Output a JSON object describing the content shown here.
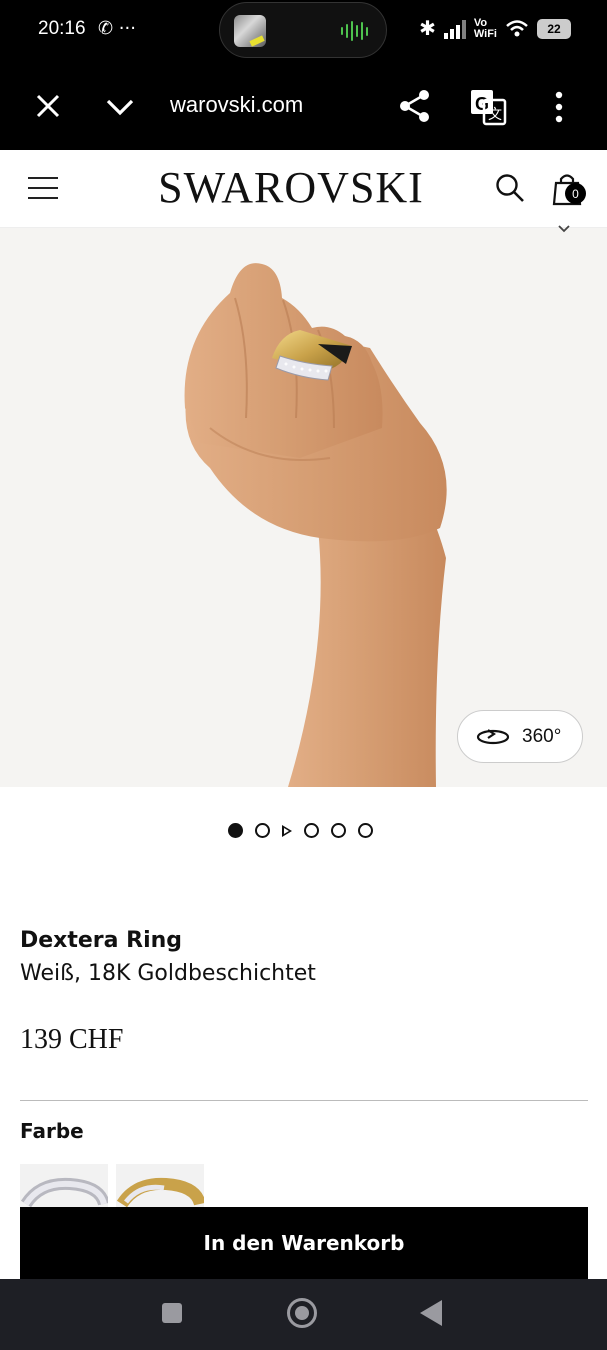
{
  "status_bar": {
    "time": "20:16",
    "left_icons": "✆ ···",
    "vowifi_line1": "Vo",
    "vowifi_line2": "WiFi",
    "battery": "22"
  },
  "browser": {
    "url": "warovski.com",
    "icons": [
      "close-icon",
      "chevron-down-icon",
      "share-icon",
      "translate-icon",
      "more-vert-icon"
    ]
  },
  "header": {
    "logo": "SWAROVSKI",
    "cart_count": "0"
  },
  "gallery": {
    "view_360_label": "360°",
    "dot_count": 6,
    "active_index": 0,
    "video_index": 2
  },
  "product": {
    "name": "Dextera Ring",
    "variant": "Weiß, 18K Goldbeschichtet",
    "price": "139 CHF",
    "color_label": "Farbe"
  },
  "actions": {
    "add_to_cart": "In den Warenkorb"
  },
  "colors": {
    "accent": "#000000",
    "skin": "#d9a27a",
    "gold": "#c9a24a"
  }
}
